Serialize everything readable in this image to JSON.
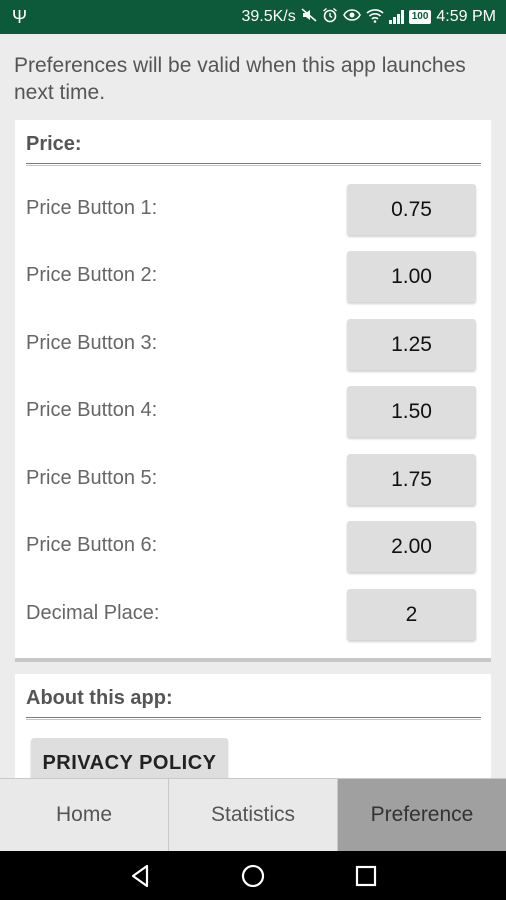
{
  "status": {
    "speed": "39.5K/s",
    "battery": "100",
    "time": "4:59 PM"
  },
  "notice": "Preferences will be valid when this app launches next time.",
  "price_section": {
    "title": "Price:",
    "rows": [
      {
        "label": "Price Button 1:",
        "value": "0.75"
      },
      {
        "label": "Price Button 2:",
        "value": "1.00"
      },
      {
        "label": "Price Button 3:",
        "value": "1.25"
      },
      {
        "label": "Price Button 4:",
        "value": "1.50"
      },
      {
        "label": "Price Button 5:",
        "value": "1.75"
      },
      {
        "label": "Price Button 6:",
        "value": "2.00"
      },
      {
        "label": "Decimal Place:",
        "value": "2"
      }
    ]
  },
  "about_section": {
    "title": "About this app:",
    "privacy_button": "PRIVACY POLICY"
  },
  "tabs": [
    {
      "label": "Home",
      "active": false
    },
    {
      "label": "Statistics",
      "active": false
    },
    {
      "label": "Preference",
      "active": true
    }
  ],
  "icons": {
    "usb": "usb-icon",
    "mute": "mute-icon",
    "alarm": "alarm-icon",
    "eye": "eye-icon",
    "wifi": "wifi-icon",
    "signal": "signal-icon",
    "battery": "battery-icon",
    "back": "back-icon",
    "home": "home-icon",
    "recents": "recents-icon"
  },
  "colors": {
    "status_bar": "#0c5a3a",
    "active_tab": "#a0a0a0",
    "field_bg": "#dedede"
  }
}
